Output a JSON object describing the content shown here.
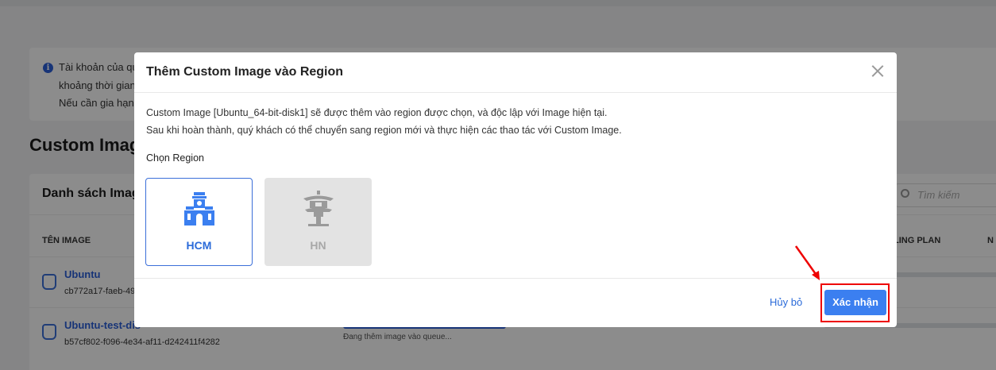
{
  "background": {
    "notice_lines": [
      "Tài khoản của qu",
      "khoảng thời gian",
      "Nếu cần gia hạn t"
    ],
    "section_title": "Custom Image",
    "list_title": "Danh sách Imag",
    "search_placeholder": "Tìm kiếm",
    "columns": [
      "TÊN IMAGE",
      "LING PLAN",
      "N"
    ],
    "rows": [
      {
        "name": "Ubuntu",
        "id": "cb772a17-faeb-49",
        "status": ""
      },
      {
        "name": "Ubuntu-test-dis",
        "id": "b57cf802-f096-4e34-af11-d242411f4282",
        "status": "Đang thêm image vào queue..."
      }
    ]
  },
  "modal": {
    "title": "Thêm Custom Image vào Region",
    "desc_line1": "Custom Image [Ubuntu_64-bit-disk1] sẽ được thêm vào region được chọn, và độc lập với Image hiện tại.",
    "desc_line2": "Sau khi hoàn thành, quý khách có thể chuyển sang region mới và thực hiện các thao tác với Custom Image.",
    "choose_label": "Chọn Region",
    "regions": [
      {
        "label": "HCM",
        "icon": "hcm-landmark-icon",
        "selected": true,
        "enabled": true
      },
      {
        "label": "HN",
        "icon": "hn-pagoda-icon",
        "selected": false,
        "enabled": false
      }
    ],
    "cancel_label": "Hủy bỏ",
    "confirm_label": "Xác nhận"
  },
  "colors": {
    "primary": "#3b7ff0",
    "link": "#2b6bd9",
    "annotation": "#ee0000",
    "disabled_bg": "#e3e3e3"
  }
}
